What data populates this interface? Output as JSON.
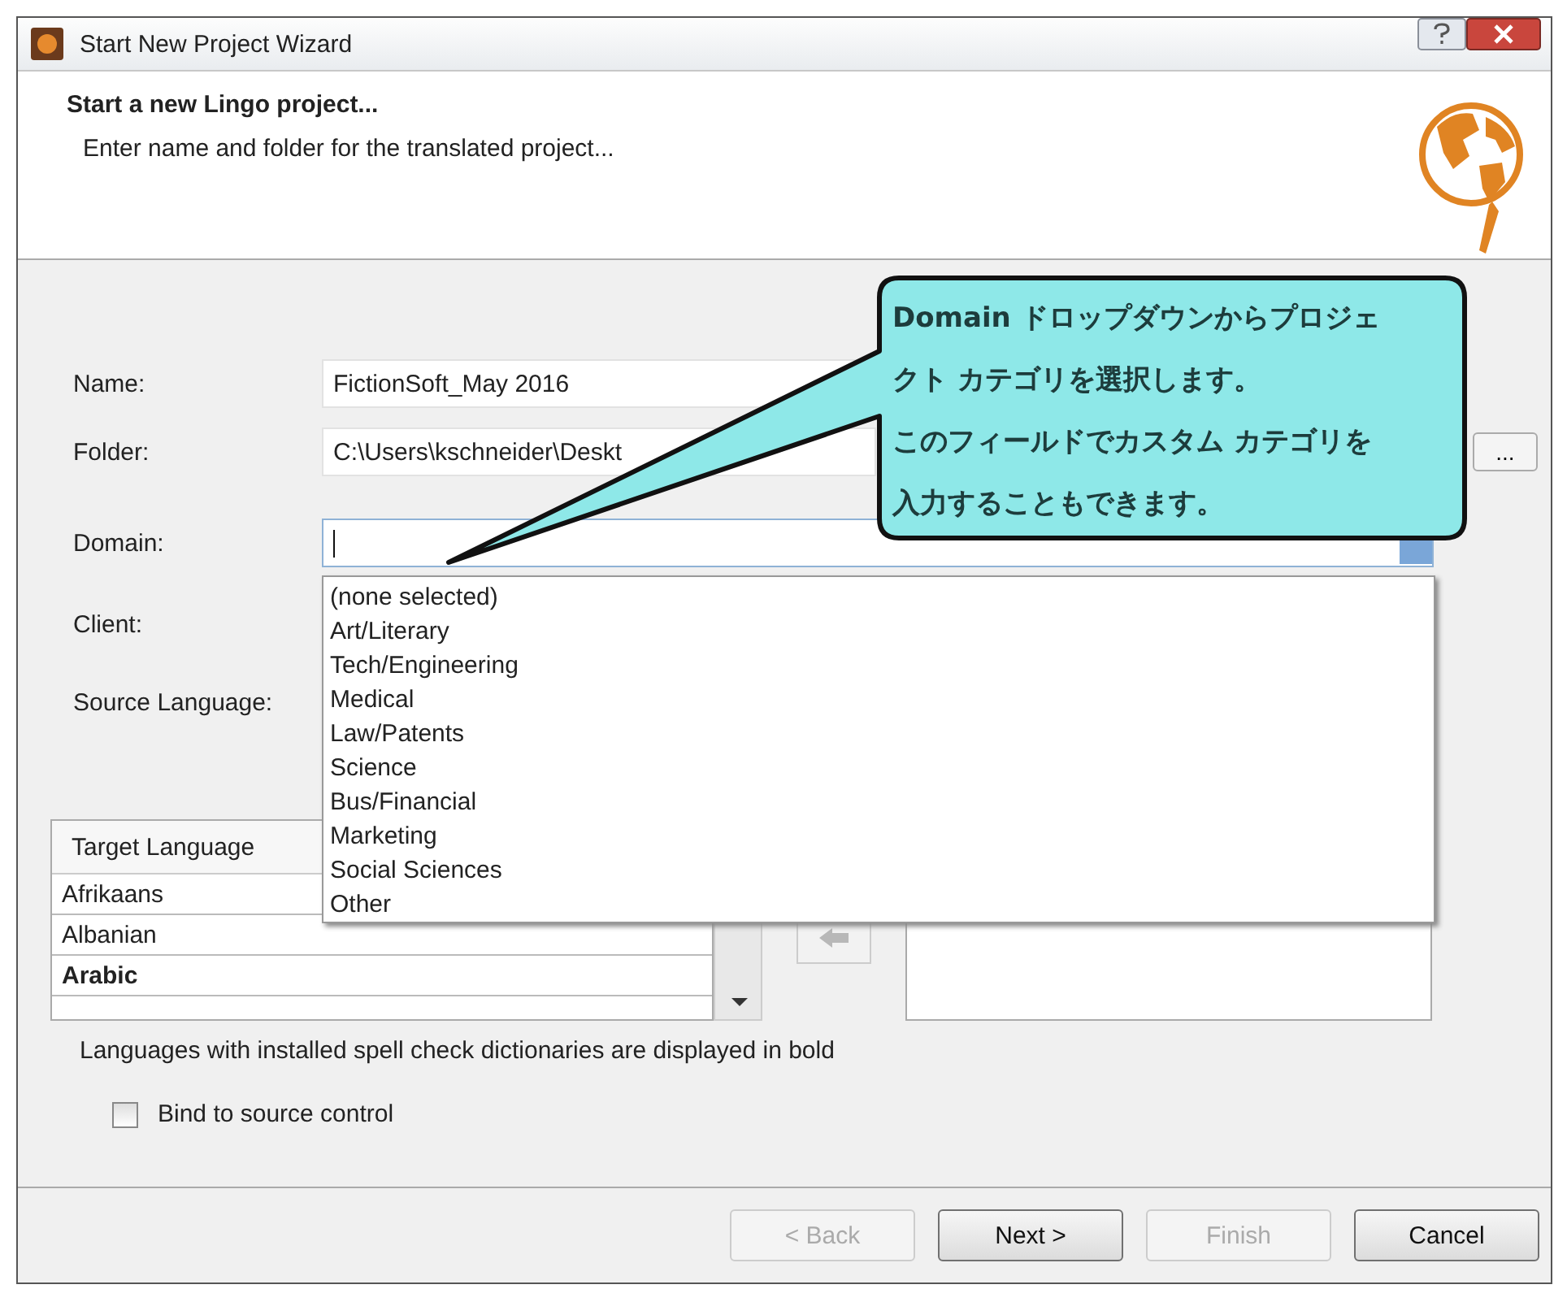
{
  "window": {
    "title": "Start New Project Wizard"
  },
  "header": {
    "title": "Start a new Lingo project...",
    "subtitle": "Enter name and folder for the translated project..."
  },
  "fields": [
    {
      "kind": "text",
      "label": "Name:",
      "value": "FictionSoft_May 2016"
    },
    {
      "kind": "browse",
      "label": "Folder:",
      "value": "C:\\Users\\kschneider\\Deskt",
      "button": "..."
    },
    {
      "kind": "combo",
      "label": "Domain:",
      "focused": true
    },
    {
      "kind": "label",
      "label": "Client:"
    },
    {
      "kind": "label",
      "label": "Source Language:"
    }
  ],
  "domain_dropdown": {
    "items": [
      {
        "label": "(none selected)",
        "selected": false
      },
      {
        "label": "Art/Literary",
        "selected": false
      },
      {
        "label": "Tech/Engineering",
        "selected": false
      },
      {
        "label": "Medical",
        "selected": false
      },
      {
        "label": "Law/Patents",
        "selected": false
      },
      {
        "label": "Science",
        "selected": false
      },
      {
        "label": "Bus/Financial",
        "selected": false
      },
      {
        "label": "Marketing",
        "selected": false
      },
      {
        "label": "Social Sciences",
        "selected": false
      },
      {
        "label": "Other",
        "selected": false
      }
    ]
  },
  "target_languages": {
    "header": "Target Language",
    "items": [
      {
        "label": "Afrikaans",
        "bold": false
      },
      {
        "label": "Albanian",
        "bold": false
      },
      {
        "label": "Arabic",
        "bold": true
      }
    ]
  },
  "note": "Languages with installed spell check dictionaries are displayed in bold",
  "bind_checkbox": {
    "label": "Bind to source control",
    "checked": false
  },
  "callout": {
    "lines": [
      "Domain ドロップダウンからプロジェ",
      "クト カテゴリを選択します。",
      "このフィールドでカスタム カテゴリを",
      "入力することもできます。"
    ]
  },
  "buttons": [
    {
      "label": "< Back",
      "disabled": true
    },
    {
      "label": "Next >",
      "disabled": false
    },
    {
      "label": "Finish",
      "disabled": true
    },
    {
      "label": "Cancel",
      "disabled": false
    }
  ]
}
